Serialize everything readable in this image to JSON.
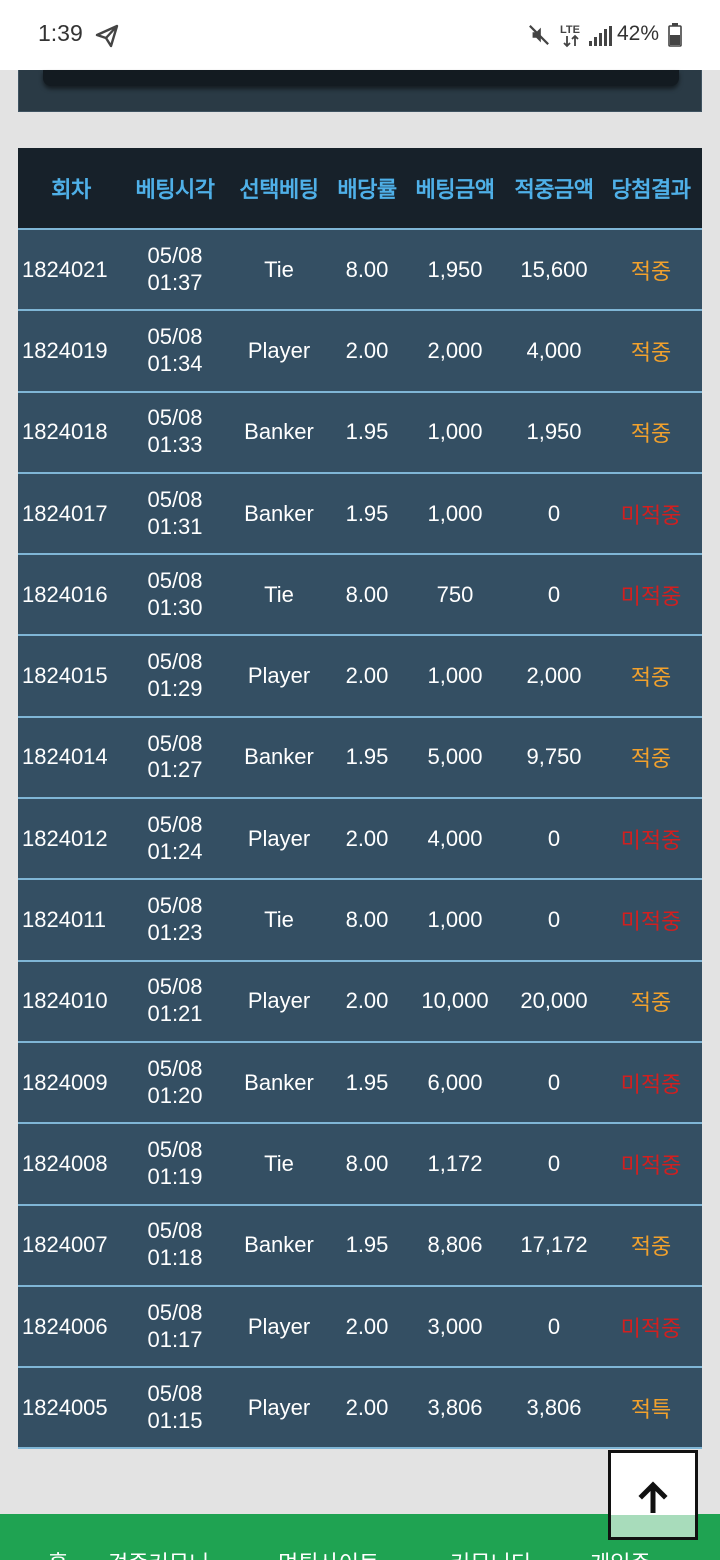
{
  "status_bar": {
    "time": "1:39",
    "battery": "42%",
    "network": "LTE",
    "icons": [
      "telegram-send-icon",
      "mute-icon",
      "lte-data-icon",
      "signal-icon",
      "battery-icon"
    ]
  },
  "table": {
    "headers": [
      "회차",
      "베팅시각",
      "선택베팅",
      "배당률",
      "베팅금액",
      "적중금액",
      "당첨결과"
    ],
    "rows": [
      {
        "round": "1824021",
        "date": "05/08",
        "time": "01:37",
        "pick": "Tie",
        "odds": "8.00",
        "bet": "1,950",
        "win": "15,600",
        "result": "적중",
        "hit": true
      },
      {
        "round": "1824019",
        "date": "05/08",
        "time": "01:34",
        "pick": "Player",
        "odds": "2.00",
        "bet": "2,000",
        "win": "4,000",
        "result": "적중",
        "hit": true
      },
      {
        "round": "1824018",
        "date": "05/08",
        "time": "01:33",
        "pick": "Banker",
        "odds": "1.95",
        "bet": "1,000",
        "win": "1,950",
        "result": "적중",
        "hit": true
      },
      {
        "round": "1824017",
        "date": "05/08",
        "time": "01:31",
        "pick": "Banker",
        "odds": "1.95",
        "bet": "1,000",
        "win": "0",
        "result": "미적중",
        "hit": false
      },
      {
        "round": "1824016",
        "date": "05/08",
        "time": "01:30",
        "pick": "Tie",
        "odds": "8.00",
        "bet": "750",
        "win": "0",
        "result": "미적중",
        "hit": false
      },
      {
        "round": "1824015",
        "date": "05/08",
        "time": "01:29",
        "pick": "Player",
        "odds": "2.00",
        "bet": "1,000",
        "win": "2,000",
        "result": "적중",
        "hit": true
      },
      {
        "round": "1824014",
        "date": "05/08",
        "time": "01:27",
        "pick": "Banker",
        "odds": "1.95",
        "bet": "5,000",
        "win": "9,750",
        "result": "적중",
        "hit": true
      },
      {
        "round": "1824012",
        "date": "05/08",
        "time": "01:24",
        "pick": "Player",
        "odds": "2.00",
        "bet": "4,000",
        "win": "0",
        "result": "미적중",
        "hit": false
      },
      {
        "round": "1824011",
        "date": "05/08",
        "time": "01:23",
        "pick": "Tie",
        "odds": "8.00",
        "bet": "1,000",
        "win": "0",
        "result": "미적중",
        "hit": false
      },
      {
        "round": "1824010",
        "date": "05/08",
        "time": "01:21",
        "pick": "Player",
        "odds": "2.00",
        "bet": "10,000",
        "win": "20,000",
        "result": "적중",
        "hit": true
      },
      {
        "round": "1824009",
        "date": "05/08",
        "time": "01:20",
        "pick": "Banker",
        "odds": "1.95",
        "bet": "6,000",
        "win": "0",
        "result": "미적중",
        "hit": false
      },
      {
        "round": "1824008",
        "date": "05/08",
        "time": "01:19",
        "pick": "Tie",
        "odds": "8.00",
        "bet": "1,172",
        "win": "0",
        "result": "미적중",
        "hit": false
      },
      {
        "round": "1824007",
        "date": "05/08",
        "time": "01:18",
        "pick": "Banker",
        "odds": "1.95",
        "bet": "8,806",
        "win": "17,172",
        "result": "적중",
        "hit": true
      },
      {
        "round": "1824006",
        "date": "05/08",
        "time": "01:17",
        "pick": "Player",
        "odds": "2.00",
        "bet": "3,000",
        "win": "0",
        "result": "미적중",
        "hit": false
      },
      {
        "round": "1824005",
        "date": "05/08",
        "time": "01:15",
        "pick": "Player",
        "odds": "2.00",
        "bet": "3,806",
        "win": "3,806",
        "result": "적특",
        "hit": true
      }
    ]
  },
  "footer_nav": {
    "items": [
      "홈",
      "검증커뮤니",
      "먹튀사이트",
      "커뮤니티",
      "게임존"
    ]
  },
  "scroll_top": {
    "icon": "arrow-up-icon"
  },
  "colors": {
    "header_bg": "#17212a",
    "header_text": "#4fb0e8",
    "row_bg": "#344f63",
    "row_divider": "#7fb6d6",
    "hit": "#f2a12c",
    "miss": "#d21f1f",
    "footer_bg": "#1fa352"
  }
}
